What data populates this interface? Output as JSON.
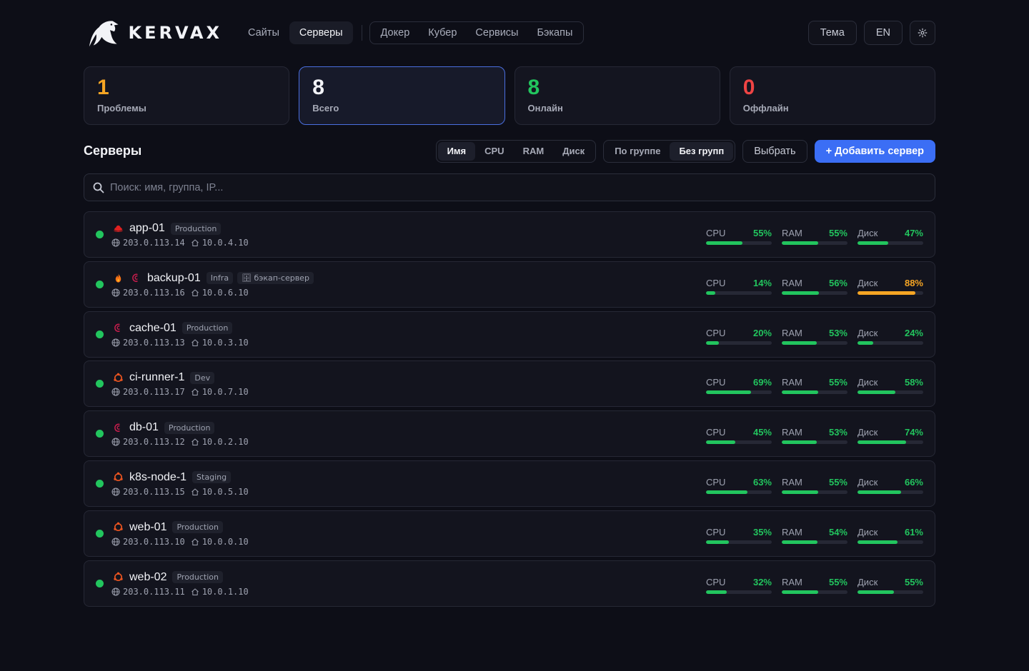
{
  "brand": {
    "name": "KERVAX"
  },
  "nav": {
    "primary": [
      {
        "label": "Сайты",
        "active": false
      },
      {
        "label": "Серверы",
        "active": true
      }
    ],
    "secondary": [
      {
        "label": "Докер"
      },
      {
        "label": "Кубер"
      },
      {
        "label": "Сервисы"
      },
      {
        "label": "Бэкапы"
      }
    ]
  },
  "header_right": {
    "theme_label": "Тема",
    "lang_label": "EN",
    "settings_icon": "gear-icon"
  },
  "stats": [
    {
      "value": "1",
      "label": "Проблемы",
      "color": "#f5a524"
    },
    {
      "value": "8",
      "label": "Всего",
      "color": "#f2f3f7",
      "selected": true
    },
    {
      "value": "8",
      "label": "Онлайн",
      "color": "#22c55e"
    },
    {
      "value": "0",
      "label": "Оффлайн",
      "color": "#ef4444"
    }
  ],
  "toolbar": {
    "title": "Серверы",
    "sort": [
      {
        "label": "Имя",
        "active": true
      },
      {
        "label": "CPU"
      },
      {
        "label": "RAM"
      },
      {
        "label": "Диск"
      }
    ],
    "group": [
      {
        "label": "По группе"
      },
      {
        "label": "Без групп",
        "active": true
      }
    ],
    "select_label": "Выбрать",
    "add_label": "+ Добавить сервер"
  },
  "search": {
    "placeholder": "Поиск: имя, группа, IP...",
    "value": ""
  },
  "metric_labels": {
    "cpu": "CPU",
    "ram": "RAM",
    "disk": "Диск"
  },
  "colors": {
    "ok": "#22c55e",
    "warn": "#f5a524",
    "online": "#22c55e"
  },
  "servers": [
    {
      "name": "app-01",
      "os": "redhat",
      "badges": [
        "Production"
      ],
      "public_ip": "203.0.113.14",
      "private_ip": "10.0.4.10",
      "cpu": 55,
      "ram": 55,
      "disk": 47
    },
    {
      "name": "backup-01",
      "os": "debian",
      "extra_icon": "fire-icon",
      "badges": [
        "Infra",
        "🗄 бэкап-сервер"
      ],
      "public_ip": "203.0.113.16",
      "private_ip": "10.0.6.10",
      "cpu": 14,
      "ram": 56,
      "disk": 88
    },
    {
      "name": "cache-01",
      "os": "debian",
      "badges": [
        "Production"
      ],
      "public_ip": "203.0.113.13",
      "private_ip": "10.0.3.10",
      "cpu": 20,
      "ram": 53,
      "disk": 24
    },
    {
      "name": "ci-runner-1",
      "os": "ubuntu",
      "badges": [
        "Dev"
      ],
      "public_ip": "203.0.113.17",
      "private_ip": "10.0.7.10",
      "cpu": 69,
      "ram": 55,
      "disk": 58
    },
    {
      "name": "db-01",
      "os": "debian",
      "badges": [
        "Production"
      ],
      "public_ip": "203.0.113.12",
      "private_ip": "10.0.2.10",
      "cpu": 45,
      "ram": 53,
      "disk": 74
    },
    {
      "name": "k8s-node-1",
      "os": "ubuntu",
      "badges": [
        "Staging"
      ],
      "public_ip": "203.0.113.15",
      "private_ip": "10.0.5.10",
      "cpu": 63,
      "ram": 55,
      "disk": 66
    },
    {
      "name": "web-01",
      "os": "ubuntu",
      "badges": [
        "Production"
      ],
      "public_ip": "203.0.113.10",
      "private_ip": "10.0.0.10",
      "cpu": 35,
      "ram": 54,
      "disk": 61
    },
    {
      "name": "web-02",
      "os": "ubuntu",
      "badges": [
        "Production"
      ],
      "public_ip": "203.0.113.11",
      "private_ip": "10.0.1.10",
      "cpu": 32,
      "ram": 55,
      "disk": 55
    }
  ]
}
